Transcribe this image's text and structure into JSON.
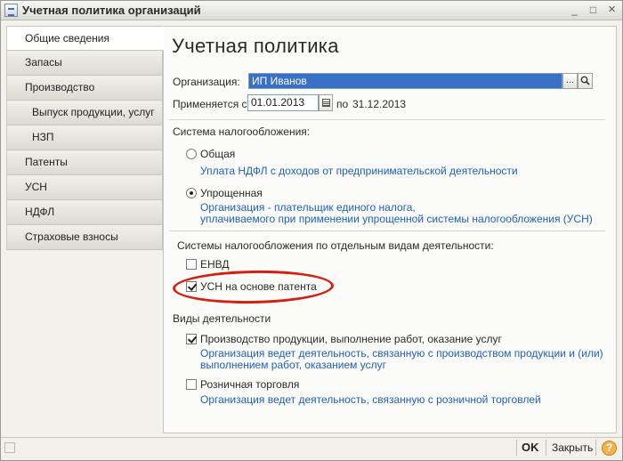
{
  "window": {
    "title": "Учетная политика организаций",
    "min_glyph": "_",
    "max_glyph": "□",
    "close_glyph": "×"
  },
  "nav": {
    "items": [
      {
        "label": "Общие сведения",
        "active": true,
        "sub": false
      },
      {
        "label": "Запасы",
        "active": false,
        "sub": false
      },
      {
        "label": "Производство",
        "active": false,
        "sub": false
      },
      {
        "label": "Выпуск продукции, услуг",
        "active": false,
        "sub": true
      },
      {
        "label": "НЗП",
        "active": false,
        "sub": true
      },
      {
        "label": "Патенты",
        "active": false,
        "sub": false
      },
      {
        "label": "УСН",
        "active": false,
        "sub": false
      },
      {
        "label": "НДФЛ",
        "active": false,
        "sub": false
      },
      {
        "label": "Страховые взносы",
        "active": false,
        "sub": false
      }
    ]
  },
  "main": {
    "heading": "Учетная политика",
    "org_label": "Организация:",
    "org_value": "ИП Иванов",
    "org_select_glyph": "...",
    "search_glyph": "🔍",
    "applies_label": "Применяется с:",
    "date_from": "01.01.2013",
    "date_to_label": "по",
    "date_to": "31.12.2013",
    "tax_system_label": "Система налогообложения:",
    "tax_options": [
      {
        "label": "Общая",
        "desc": "Уплата НДФЛ с доходов от предпринимательской деятельности",
        "selected": false
      },
      {
        "label": "Упрощенная",
        "desc1": "Организация - плательщик единого налога,",
        "desc2": "уплачиваемого при применении упрощенной системы налогообложения (УСН)",
        "selected": true
      }
    ],
    "special_systems_label": "Системы налогообложения по отдельным видам деятельности:",
    "envd": {
      "label": "ЕНВД",
      "checked": false
    },
    "patent": {
      "label": "УСН на основе патента",
      "checked": true
    },
    "activity_label": "Виды деятельности",
    "activities": [
      {
        "label": "Производство  продукции, выполнение работ, оказание услуг",
        "checked": true,
        "desc1": "Организация ведет деятельность, связанную с производством продукции и (или)",
        "desc2": "выполнением работ, оказанием услуг"
      },
      {
        "label": "Розничная торговля",
        "checked": false,
        "desc1": "Организация ведет деятельность, связанную с розничной торговлей"
      }
    ]
  },
  "footer": {
    "ok_label": "OK",
    "close_label": "Закрыть",
    "help_glyph": "?"
  },
  "colors": {
    "accent_blue": "#1f5fbf",
    "selection": "#3a6fc7",
    "highlight_oval": "#d51f10",
    "help_orange": "#f3b24b"
  }
}
